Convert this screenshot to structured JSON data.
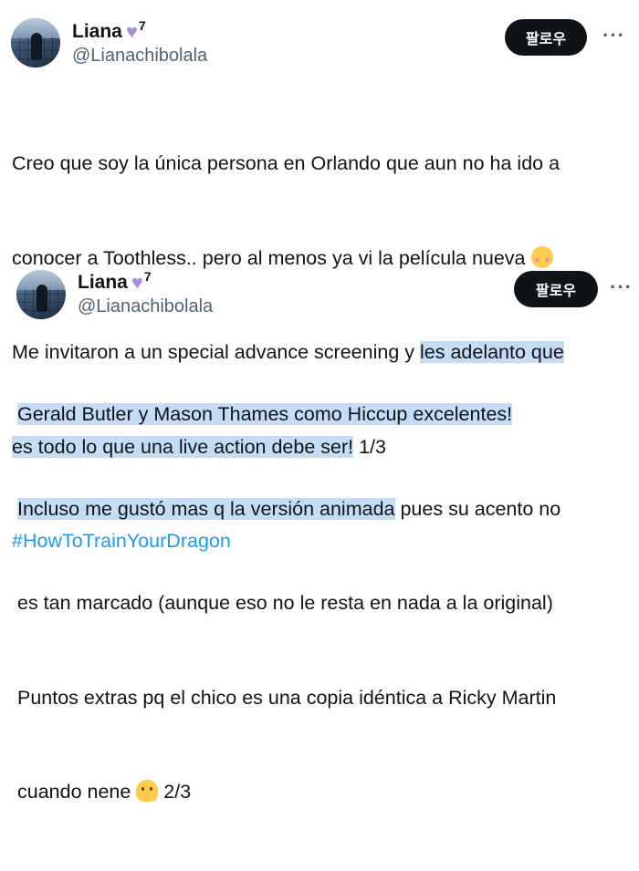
{
  "tweets": [
    {
      "author": {
        "name": "Liana",
        "badge": "7",
        "handle": "@Lianachibolala",
        "heart_icon": "purple-heart"
      },
      "follow_label": "팔로우",
      "more_label": "···",
      "lines": [
        [
          "Creo que soy la única persona en Orlando que aun no ha ido a"
        ],
        [
          "conocer a Toothless.. pero al menos ya vi la película nueva "
        ],
        [
          "Me invitaron a un special advance screening y ",
          "les adelanto que"
        ],
        [
          "es todo lo que una live action debe ser!",
          " 1/3"
        ],
        [
          "#HowToTrainYourDragon"
        ]
      ]
    },
    {
      "author": {
        "name": "Liana",
        "badge": "7",
        "handle": "@Lianachibolala",
        "heart_icon": "purple-heart"
      },
      "follow_label": "팔로우",
      "more_label": "···",
      "lines": [
        [
          "Gerald Butler y Mason Thames como Hiccup excelentes!"
        ],
        [
          "Incluso me gustó mas q la versión animada",
          " pues su acento no"
        ],
        [
          "es tan marcado (aunque eso no le resta en nada a la original)"
        ],
        [
          "Puntos extras pq el chico es una copia idéntica a Ricky Martin"
        ],
        [
          "cuando nene ",
          " 2/3"
        ]
      ]
    }
  ],
  "colors": {
    "highlight": "#c5dcf5",
    "hashtag": "#1d9bf0",
    "follow_bg": "#0f1419",
    "secondary": "#536471"
  }
}
